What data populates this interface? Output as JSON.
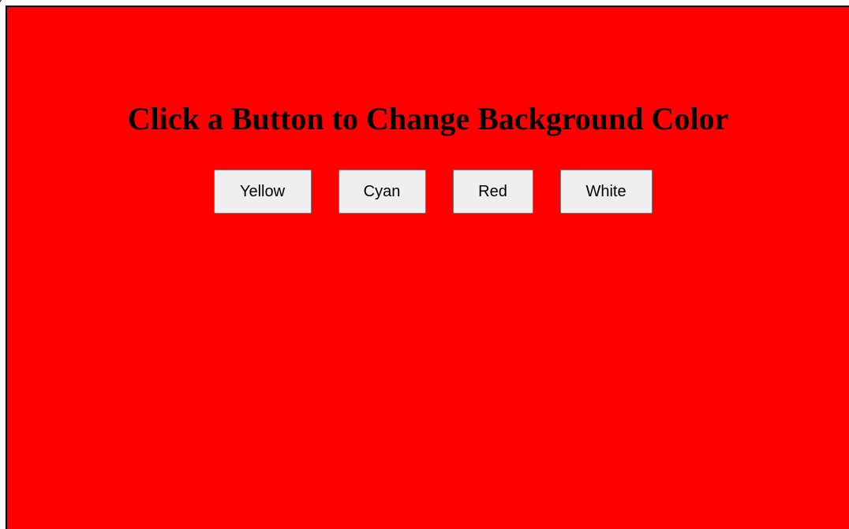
{
  "page": {
    "background_color": "#ff0000",
    "corner_glyph": ")"
  },
  "heading": "Click a Button to Change Background Color",
  "buttons": [
    {
      "label": "Yellow",
      "color": "#ffff00"
    },
    {
      "label": "Cyan",
      "color": "#00ffff"
    },
    {
      "label": "Red",
      "color": "#ff0000"
    },
    {
      "label": "White",
      "color": "#ffffff"
    }
  ]
}
